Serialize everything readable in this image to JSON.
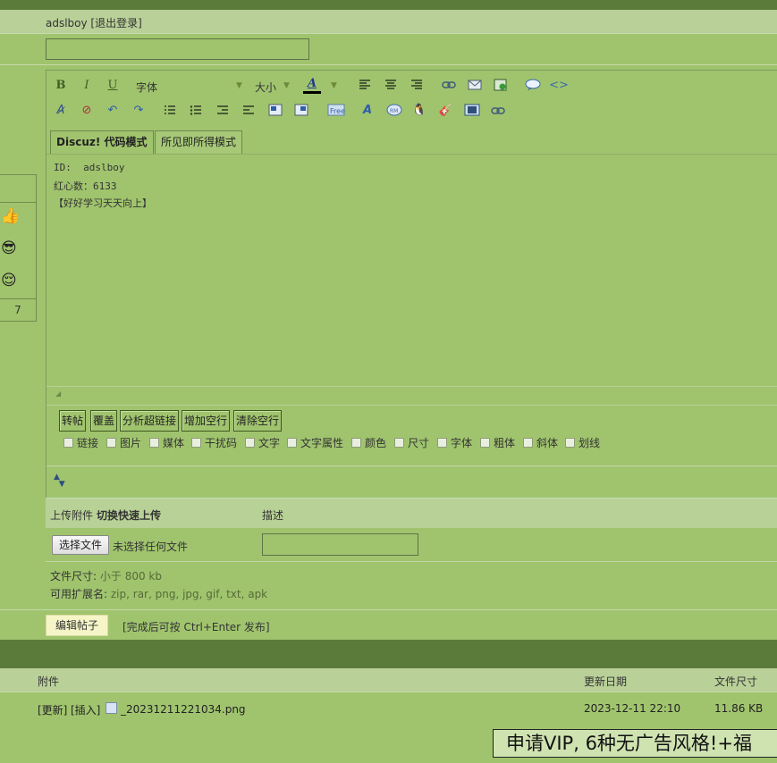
{
  "user": {
    "name_line": "adslboy [退出登录]"
  },
  "toolbar": {
    "bold": "B",
    "italic": "I",
    "underline": "U",
    "font_label": "字体",
    "size_label": "大小",
    "font_color_glyph": "A"
  },
  "tabs": [
    "Discuz! 代码模式",
    "所见即所得模式"
  ],
  "editor": {
    "lines": [
      "ID:  adslboy",
      "红心数：6133",
      "【好好学习天天向上】"
    ]
  },
  "editor_buttons": [
    "转帖",
    "覆盖",
    "分析超链接",
    "增加空行",
    "清除空行"
  ],
  "strip_options": [
    "链接",
    "图片",
    "媒体",
    "干扰码",
    "文字",
    "文字属性",
    "颜色",
    "尺寸",
    "字体",
    "粗体",
    "斜体",
    "划线"
  ],
  "sidebar": {
    "smileys": [
      "👍",
      "😎",
      "😌"
    ],
    "count": "7"
  },
  "attachments": {
    "upload_label": "上传附件",
    "switch_label": "切换快速上传",
    "desc_label": "描述",
    "choose_file": "选择文件",
    "no_file": "未选择任何文件",
    "size_prefix": "文件尺寸:",
    "size_value": "小于 800 kb",
    "ext_prefix": "可用扩展名:",
    "ext_value": "zip, rar, png, jpg, gif, txt, apk"
  },
  "submit": {
    "label": "编辑帖子",
    "hint": "[完成后可按 Ctrl+Enter 发布]"
  },
  "table": {
    "headers": {
      "attachment": "附件",
      "date": "更新日期",
      "size": "文件尺寸"
    },
    "row": {
      "update": "[更新]",
      "insert": "[插入]",
      "filename": "_20231211221034.png",
      "date": "2023-12-11 22:10",
      "size": "11.86 KB"
    }
  },
  "vip_banner": "申请VIP, 6种无广告风格!+福",
  "colors": {
    "background": "#a0c46e",
    "dark_bar": "#5b7b3b",
    "header_band": "#b9d098"
  }
}
